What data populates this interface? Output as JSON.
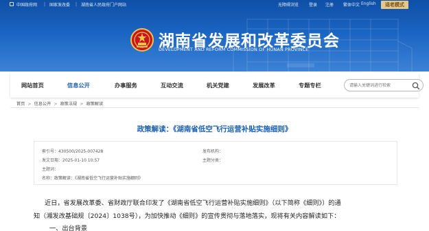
{
  "topbar": {
    "links": [
      "中国政府网",
      "国家发改委",
      "湖南省人民政府门户网站"
    ],
    "right": [
      "无障碍浏览",
      "登录",
      "注册",
      "繁体中文",
      "English"
    ],
    "elder_mode": "适老模式"
  },
  "header": {
    "title": "湖南省发展和改革委员会",
    "subtitle": "DEVELOPMENT AND REFORM COMMISSION OF HUNAN PROVINCE"
  },
  "nav": {
    "items": [
      "网站首页",
      "信息公开",
      "办事服务",
      "互动交流",
      "机关党建",
      "发展改革",
      "专题专栏"
    ],
    "search_placeholder": "请输入关键词进行检索"
  },
  "breadcrumb": [
    "首页",
    "信息公开",
    "政策法规",
    "政策解读"
  ],
  "article": {
    "title": "政策解读：《湖南省低空飞行运营补贴实施细则》",
    "meta": {
      "index_label": "索引号：",
      "index_value": "430500/2025-007428",
      "org_label": "发布机构：",
      "org_value": "",
      "date_label": "发文日期：",
      "date_value": "2025-01-10 10:57",
      "topic_label": "主题分类：",
      "topic_value": "",
      "keywords_label": "主题词：",
      "keywords_value": "",
      "name_label": "名称：",
      "name_value": "政策解读：《湖南省低空飞行运营补贴实施细则》"
    },
    "para1": "近日，省发展改革委、省财政厅联合印发了《湖南省低空飞行运营补贴实施细则》（以下简称《细则》）的通",
    "para2": "知（湘发改基础规〔2024〕1038号），为加快推动《细则》的宣传贯彻与落地落实，现将有关内容解读如下：",
    "para3": "一、出台背景"
  },
  "colors": {
    "banner": "#1a64c2",
    "nav_active": "#1a5fb4",
    "title_blue": "#1a5fb4",
    "elder_btn": "#e4c88b"
  }
}
